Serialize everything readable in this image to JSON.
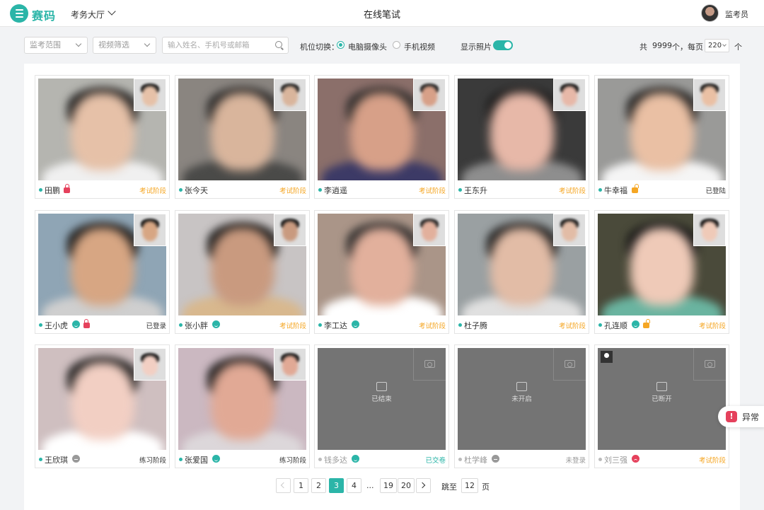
{
  "app": {
    "brand": "赛码",
    "hall": "考务大厅",
    "title": "在线笔试",
    "user_role": "监考员",
    "colors": {
      "accent": "#2bb5a8",
      "warning": "#f5a623",
      "danger": "#e5415c"
    }
  },
  "filters": {
    "scope_placeholder": "监考范围",
    "video_placeholder": "视频筛选",
    "search_placeholder": "输入姓名、手机号或邮箱",
    "camera_switch_label": "机位切换：",
    "camera_options": [
      "电脑摄像头",
      "手机视频"
    ],
    "camera_selected": "电脑摄像头",
    "show_photo_label": "显示照片",
    "show_photo_on": true,
    "total_prefix": "共",
    "total_count": "9999",
    "total_suffix": "个，每页",
    "per_page": "220",
    "per_page_unit": "个"
  },
  "candidates": [
    {
      "name": "田鹏",
      "status": "考试阶段",
      "status_color": "orange",
      "icons": [
        "lock-red"
      ],
      "online": true,
      "video": "on"
    },
    {
      "name": "张今天",
      "status": "考试阶段",
      "status_color": "orange",
      "icons": [],
      "online": true,
      "video": "on"
    },
    {
      "name": "李逍遥",
      "status": "考试阶段",
      "status_color": "orange",
      "icons": [],
      "online": true,
      "video": "on"
    },
    {
      "name": "王东升",
      "status": "考试阶段",
      "status_color": "orange",
      "icons": [],
      "online": true,
      "video": "on"
    },
    {
      "name": "牛幸福",
      "status": "已登陆",
      "status_color": "dark",
      "icons": [
        "lock-orange"
      ],
      "online": true,
      "video": "on"
    },
    {
      "name": "王小虎",
      "status": "已登录",
      "status_color": "dark",
      "icons": [
        "smile",
        "lock-red"
      ],
      "online": true,
      "video": "on"
    },
    {
      "name": "张小胖",
      "status": "考试阶段",
      "status_color": "orange",
      "icons": [
        "smile"
      ],
      "online": true,
      "video": "on"
    },
    {
      "name": "李工达",
      "status": "考试阶段",
      "status_color": "orange",
      "icons": [
        "smile"
      ],
      "online": true,
      "video": "on"
    },
    {
      "name": "杜子腾",
      "status": "考试阶段",
      "status_color": "orange",
      "icons": [],
      "online": true,
      "video": "on"
    },
    {
      "name": "孔连顺",
      "status": "考试阶段",
      "status_color": "orange",
      "icons": [
        "smile",
        "lock-orange"
      ],
      "online": true,
      "video": "on"
    },
    {
      "name": "王欣琪",
      "status": "练习阶段",
      "status_color": "dark",
      "icons": [
        "neutral"
      ],
      "online": true,
      "video": "on"
    },
    {
      "name": "张爱国",
      "status": "练习阶段",
      "status_color": "dark",
      "icons": [
        "smile"
      ],
      "online": true,
      "video": "on"
    },
    {
      "name": "钱多达",
      "status": "已交卷",
      "status_color": "teal",
      "icons": [
        "smile"
      ],
      "online": false,
      "video": "off",
      "video_state": "已结束"
    },
    {
      "name": "杜学峰",
      "status": "未登录",
      "status_color": "grey",
      "icons": [
        "neutral"
      ],
      "online": false,
      "video": "off",
      "video_state": "未开启"
    },
    {
      "name": "刘三强",
      "status": "考试阶段",
      "status_color": "orange",
      "icons": [
        "sad"
      ],
      "online": false,
      "video": "off",
      "video_state": "已断开",
      "flagged": true
    }
  ],
  "pagination": {
    "pages": [
      "1",
      "2",
      "3",
      "4",
      "...",
      "19",
      "20"
    ],
    "current": "3",
    "goto_label": "跳至",
    "goto_value": "12",
    "page_unit": "页"
  },
  "anomaly": {
    "label": "异常"
  }
}
